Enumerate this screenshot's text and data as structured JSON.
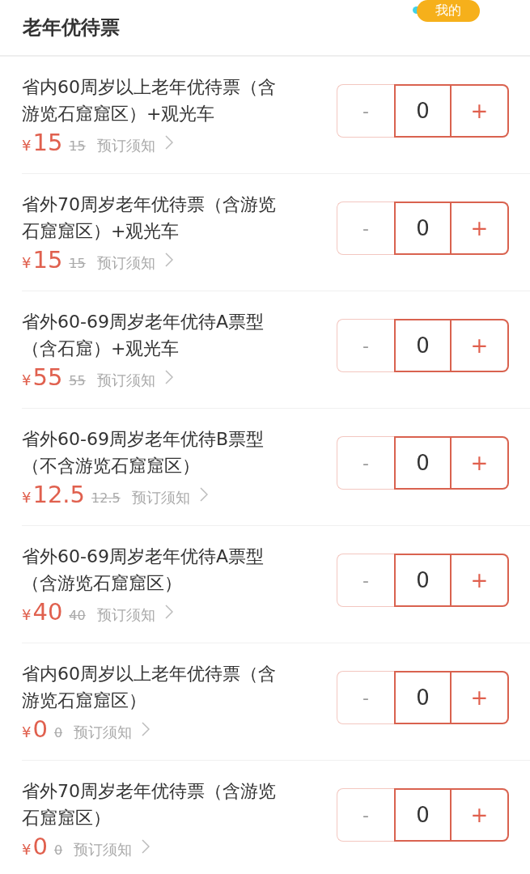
{
  "header": {
    "title": "老年优待票",
    "badge": "我的"
  },
  "tickets": [
    {
      "name_lines": [
        "省内60周岁以上老年优待票（含",
        "游览石窟窟区）+观光车"
      ],
      "currency": "¥",
      "price": "15",
      "original_price": "15",
      "notice": "预订须知",
      "minus": "-",
      "quantity": "0",
      "plus": "+",
      "minus_disabled": true
    },
    {
      "name_lines": [
        "省外70周岁老年优待票（含游览",
        "石窟窟区）+观光车"
      ],
      "currency": "¥",
      "price": "15",
      "original_price": "15",
      "notice": "预订须知",
      "minus": "-",
      "quantity": "0",
      "plus": "+",
      "minus_disabled": true
    },
    {
      "name_lines": [
        "省外60-69周岁老年优待A票型",
        "（含石窟）+观光车"
      ],
      "currency": "¥",
      "price": "55",
      "original_price": "55",
      "notice": "预订须知",
      "minus": "-",
      "quantity": "0",
      "plus": "+",
      "minus_disabled": true
    },
    {
      "name_lines": [
        "省外60-69周岁老年优待B票型",
        "（不含游览石窟窟区）"
      ],
      "currency": "¥",
      "price": "12.5",
      "original_price": "12.5",
      "notice": "预订须知",
      "minus": "-",
      "quantity": "0",
      "plus": "+",
      "minus_disabled": true
    },
    {
      "name_lines": [
        "省外60-69周岁老年优待A票型",
        "（含游览石窟窟区）"
      ],
      "currency": "¥",
      "price": "40",
      "original_price": "40",
      "notice": "预订须知",
      "minus": "-",
      "quantity": "0",
      "plus": "+",
      "minus_disabled": true
    },
    {
      "name_lines": [
        "省内60周岁以上老年优待票（含",
        "游览石窟窟区）"
      ],
      "currency": "¥",
      "price": "0",
      "original_price": "0",
      "notice": "预订须知",
      "minus": "-",
      "quantity": "0",
      "plus": "+",
      "minus_disabled": true
    },
    {
      "name_lines": [
        "省外70周岁老年优待票（含游览",
        "石窟窟区）"
      ],
      "currency": "¥",
      "price": "0",
      "original_price": "0",
      "notice": "预订须知",
      "minus": "-",
      "quantity": "0",
      "plus": "+",
      "minus_disabled": true
    }
  ]
}
